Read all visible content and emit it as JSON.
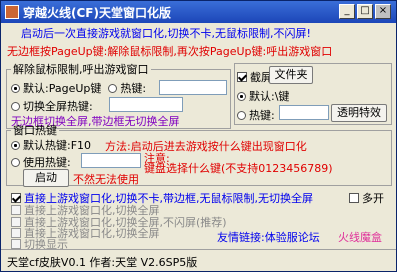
{
  "title": "穿越火线(CF)天堂窗口化版",
  "titlebar": {
    "minimize": "_",
    "maximize": "□",
    "close": "×"
  },
  "banner_line1": "启动后一次直接游戏就窗口化,切换不卡,无鼠标限制,不闪屏!",
  "banner_line2": "无边框按PageUp键:解除鼠标限制,再次按PageUp键:呼出游戏窗口",
  "mouse_group": {
    "legend": "解除鼠标限制,呼出游戏窗口",
    "default_label": "默认:PageUp键",
    "hotkey_label": "热键:",
    "fullscreen_label": "切换全屏热键:",
    "note": "无边框切换全屏,带边框无切换全屏"
  },
  "screenshot_group": {
    "label": "截屏",
    "folder_button": "文件夹",
    "default_label": "默认:\\键",
    "hotkey_label": "热键:",
    "effect_button": "透明特效"
  },
  "window_hotkey_group": {
    "legend": "窗口热键",
    "default_label": "默认热键:F10",
    "use_hotkey_label": "使用热键:",
    "method_note": "方法:启动后进去游戏按什么键出现窗口化",
    "attention": "注意:",
    "key_note": "键盘选择什么键(不支持0123456789)",
    "start_button": "启动",
    "invalid_note": "不然无法使用"
  },
  "options": [
    {
      "label": "直接上游戏窗口化,切换不卡,带边框,无鼠标限制,无切换全屏",
      "checked": true,
      "disabled": false
    },
    {
      "label": "直接上游戏窗口化,切换全屏",
      "checked": false,
      "disabled": true
    },
    {
      "label": "直接上游戏窗口化,切换全屏,不闪屏(推荐)",
      "checked": false,
      "disabled": true
    },
    {
      "label": "直接上游戏窗口化,切换全屏",
      "checked": false,
      "disabled": true
    },
    {
      "label": "切换显示",
      "checked": false,
      "disabled": true
    }
  ],
  "multi_open_label": "多开",
  "friend_link": "友情链接:体验服论坛",
  "fire_link": "火线魔盒",
  "status": "天堂cf皮肤V0.1 作者:天堂 V2.6SP5版"
}
